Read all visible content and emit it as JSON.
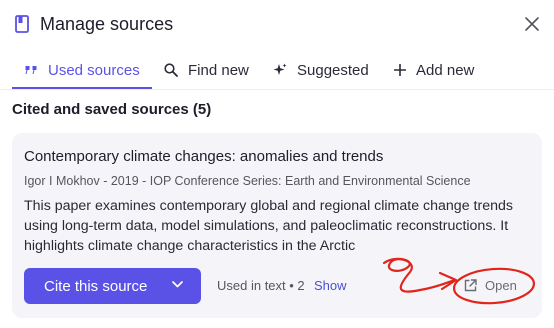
{
  "header": {
    "title": "Manage sources",
    "icons": {
      "book": "book-icon",
      "close": "close-icon"
    }
  },
  "tabs": [
    {
      "label": "Used sources",
      "icon": "quote-icon",
      "active": true
    },
    {
      "label": "Find new",
      "icon": "search-icon",
      "active": false
    },
    {
      "label": "Suggested",
      "icon": "sparkle-icon",
      "active": false
    },
    {
      "label": "Add new",
      "icon": "plus-icon",
      "active": false
    }
  ],
  "section": {
    "title": "Cited and saved sources (5)"
  },
  "source_card": {
    "title": "Contemporary climate changes: anomalies and trends",
    "meta": "Igor I Mokhov - 2019 - IOP Conference Series: Earth and Environmental Science",
    "description": "This paper examines contemporary global and regional climate change trends using long-term data, model simulations, and paleoclimatic reconstructions. It highlights climate change characteristics in the Arctic",
    "cite_button_label": "Cite this source",
    "used_in_text": "Used in text • 2",
    "show_label": "Show",
    "open_label": "Open"
  },
  "colors": {
    "accent": "#5a52e6",
    "card_background": "#f5f5f9",
    "annotation_red": "#e0251b"
  }
}
